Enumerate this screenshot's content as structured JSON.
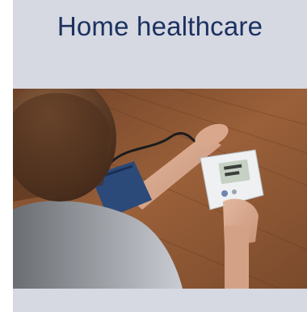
{
  "card": {
    "title": "Home healthcare"
  },
  "photo": {
    "subject": "person-measuring-blood-pressure",
    "monitor_display": "digital-readout"
  },
  "colors": {
    "card_background": "#d6d9e1",
    "title_text": "#1c3161",
    "table_wood": "#8a5330",
    "cuff": "#2b4a7a",
    "monitor": "#eef0f2"
  }
}
